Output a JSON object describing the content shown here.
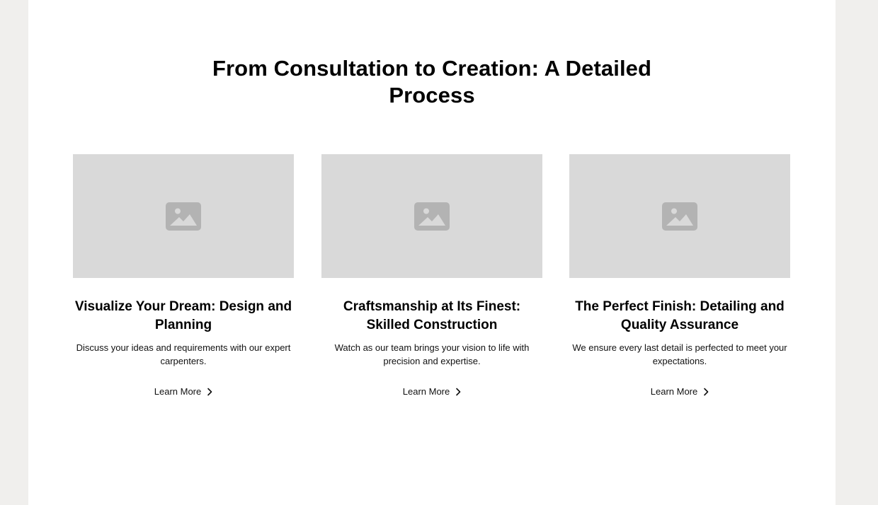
{
  "section": {
    "title": "From Consultation to Creation: A Detailed Process"
  },
  "cards": [
    {
      "image_icon": "image-placeholder-icon",
      "title": "Visualize Your Dream: Design and Planning",
      "description": "Discuss your ideas and requirements with our expert carpenters.",
      "link_label": "Learn More",
      "link_icon": "chevron-right-icon"
    },
    {
      "image_icon": "image-placeholder-icon",
      "title": "Craftsmanship at Its Finest: Skilled Construction",
      "description": "Watch as our team brings your vision to life with precision and expertise.",
      "link_label": "Learn More",
      "link_icon": "chevron-right-icon"
    },
    {
      "image_icon": "image-placeholder-icon",
      "title": "The Perfect Finish: Detailing and Quality Assurance",
      "description": "We ensure every last detail is perfected to meet your expectations.",
      "link_label": "Learn More",
      "link_icon": "chevron-right-icon"
    }
  ],
  "colors": {
    "outer_background": "#f0efed",
    "page_background": "#ffffff",
    "placeholder_background": "#d9d9d9",
    "placeholder_icon": "#b3b3b3",
    "text": "#000000"
  }
}
